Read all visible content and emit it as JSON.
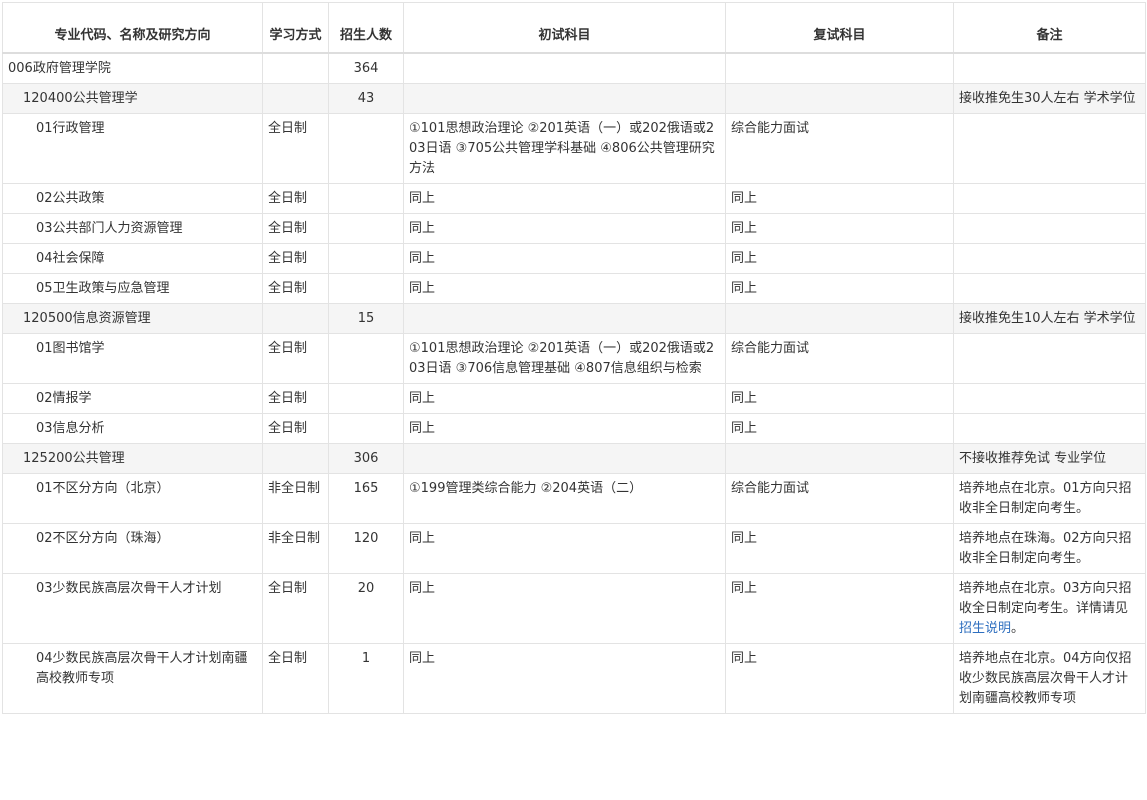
{
  "headers": {
    "major": "专业代码、名称及研究方向",
    "mode": "学习方式",
    "quota": "招生人数",
    "prelim": "初试科目",
    "retest": "复试科目",
    "remark": "备注"
  },
  "rows": [
    {
      "level": 0,
      "kind": "school",
      "name": "006政府管理学院",
      "mode": "",
      "quota": "364",
      "prelim": "",
      "retest": "",
      "remark": ""
    },
    {
      "level": 1,
      "kind": "major",
      "name": "120400公共管理学",
      "mode": "",
      "quota": "43",
      "prelim": "",
      "retest": "",
      "remark": "接收推免生30人左右 学术学位"
    },
    {
      "level": 2,
      "kind": "direction",
      "name": "01行政管理",
      "mode": "全日制",
      "quota": "",
      "prelim": "①101思想政治理论 ②201英语（一）或202俄语或203日语 ③705公共管理学科基础 ④806公共管理研究方法",
      "retest": "综合能力面试",
      "remark": ""
    },
    {
      "level": 2,
      "kind": "direction",
      "name": "02公共政策",
      "mode": "全日制",
      "quota": "",
      "prelim": "同上",
      "retest": "同上",
      "remark": ""
    },
    {
      "level": 2,
      "kind": "direction",
      "name": "03公共部门人力资源管理",
      "mode": "全日制",
      "quota": "",
      "prelim": "同上",
      "retest": "同上",
      "remark": ""
    },
    {
      "level": 2,
      "kind": "direction",
      "name": "04社会保障",
      "mode": "全日制",
      "quota": "",
      "prelim": "同上",
      "retest": "同上",
      "remark": ""
    },
    {
      "level": 2,
      "kind": "direction",
      "name": "05卫生政策与应急管理",
      "mode": "全日制",
      "quota": "",
      "prelim": "同上",
      "retest": "同上",
      "remark": ""
    },
    {
      "level": 1,
      "kind": "major",
      "name": "120500信息资源管理",
      "mode": "",
      "quota": "15",
      "prelim": "",
      "retest": "",
      "remark": "接收推免生10人左右 学术学位"
    },
    {
      "level": 2,
      "kind": "direction",
      "name": "01图书馆学",
      "mode": "全日制",
      "quota": "",
      "prelim": "①101思想政治理论 ②201英语（一）或202俄语或203日语 ③706信息管理基础 ④807信息组织与检索",
      "retest": "综合能力面试",
      "remark": ""
    },
    {
      "level": 2,
      "kind": "direction",
      "name": "02情报学",
      "mode": "全日制",
      "quota": "",
      "prelim": "同上",
      "retest": "同上",
      "remark": ""
    },
    {
      "level": 2,
      "kind": "direction",
      "name": "03信息分析",
      "mode": "全日制",
      "quota": "",
      "prelim": "同上",
      "retest": "同上",
      "remark": ""
    },
    {
      "level": 1,
      "kind": "major",
      "name": "125200公共管理",
      "mode": "",
      "quota": "306",
      "prelim": "",
      "retest": "",
      "remark": "不接收推荐免试 专业学位"
    },
    {
      "level": 2,
      "kind": "direction",
      "name": "01不区分方向（北京）",
      "mode": "非全日制",
      "quota": "165",
      "prelim": "①199管理类综合能力 ②204英语（二）",
      "retest": "综合能力面试",
      "remark": "培养地点在北京。01方向只招收非全日制定向考生。"
    },
    {
      "level": 2,
      "kind": "direction",
      "name": "02不区分方向（珠海）",
      "mode": "非全日制",
      "quota": "120",
      "prelim": "同上",
      "retest": "同上",
      "remark": "培养地点在珠海。02方向只招收非全日制定向考生。"
    },
    {
      "level": 2,
      "kind": "direction",
      "name": "03少数民族高层次骨干人才计划",
      "mode": "全日制",
      "quota": "20",
      "prelim": "同上",
      "retest": "同上",
      "remark": "培养地点在北京。03方向只招收全日制定向考生。详情请见",
      "remark_link": "招生说明",
      "remark_tail": "。"
    },
    {
      "level": 2,
      "kind": "direction",
      "name": "04少数民族高层次骨干人才计划南疆高校教师专项",
      "mode": "全日制",
      "quota": "1",
      "prelim": "同上",
      "retest": "同上",
      "remark": "培养地点在北京。04方向仅招收少数民族高层次骨干人才计划南疆高校教师专项"
    }
  ]
}
